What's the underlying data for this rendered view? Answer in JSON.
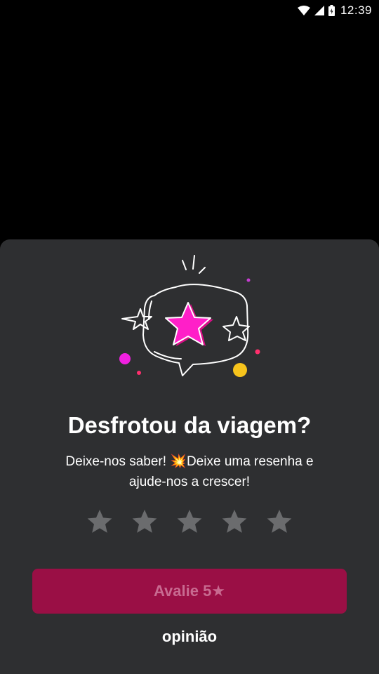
{
  "status_bar": {
    "time": "12:39",
    "icons": [
      "wifi-icon",
      "signal-icon",
      "battery-icon"
    ]
  },
  "dialog": {
    "illustration": "star-speech-bubble-illustration",
    "title": "Desfrotou da viagem?",
    "subtitle_line1": "Deixe-nos saber! 💥Deixe uma resenha e",
    "subtitle_line2": "ajude-nos a crescer!",
    "rating": {
      "max": 5,
      "selected": 0
    },
    "rate_button_label": "Avalie 5★",
    "opinion_label": "opinião"
  },
  "colors": {
    "sheet_bg": "#2e2f31",
    "star_inactive": "#6b6c6e",
    "button_bg": "#9a0f45",
    "button_text": "#c86a90",
    "accent_pink": "#ff1fae"
  }
}
